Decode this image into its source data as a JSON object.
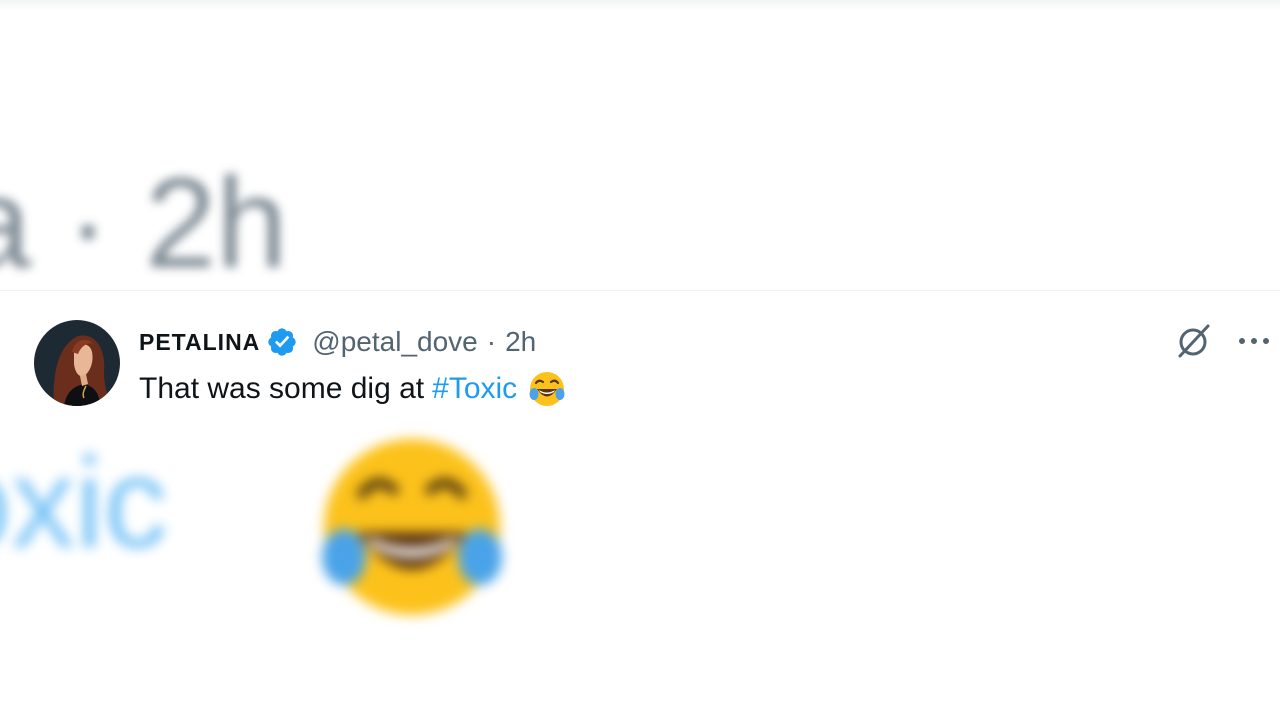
{
  "background": {
    "zoom_top_text": "a · 2h",
    "zoom_bottom_text": "oxic"
  },
  "tweet": {
    "display_name": "PETALINA",
    "handle": "@petal_dove",
    "separator": "·",
    "time": "2h",
    "text_before": "That was some dig at",
    "hashtag": "#Toxic",
    "emoji_icon": "face-with-tears-of-joy-icon",
    "verified_icon": "verified-badge-icon"
  },
  "actions": {
    "grok_icon": "grok-icon",
    "more_icon": "more-options-icon"
  },
  "colors": {
    "text_primary": "#0f1419",
    "text_secondary": "#536471",
    "accent": "#1d9bf0",
    "background": "#ffffff"
  }
}
